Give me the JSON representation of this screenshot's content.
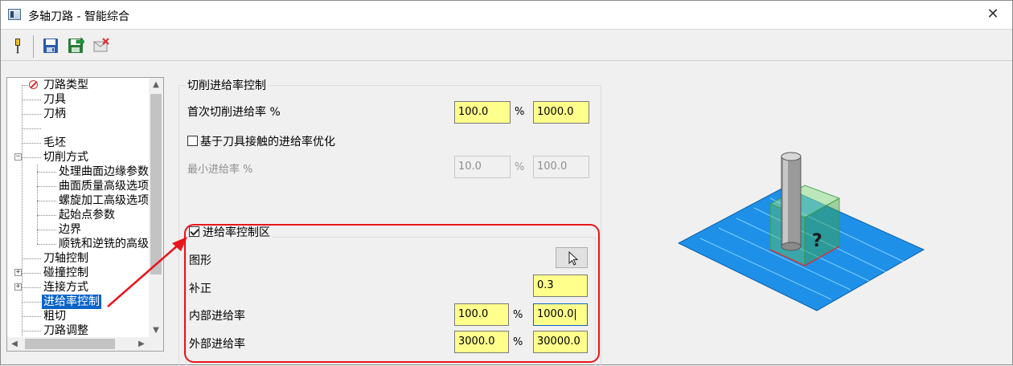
{
  "window": {
    "title": "多轴刀路 - 智能综合",
    "close_glyph": "✕"
  },
  "toolbar": {
    "buttons": [
      {
        "name": "tool-icon"
      },
      {
        "name": "save-icon"
      },
      {
        "name": "save-as-icon"
      },
      {
        "name": "cancel-icon"
      }
    ]
  },
  "tree": {
    "items": [
      {
        "label": "刀路类型",
        "level": 0,
        "icon": "no-sign-icon"
      },
      {
        "label": "刀具",
        "level": 0
      },
      {
        "label": "刀柄",
        "level": 0
      },
      {
        "label": "",
        "level": 0
      },
      {
        "label": "毛坯",
        "level": 0
      },
      {
        "label": "切削方式",
        "level": 0,
        "expander": "−"
      },
      {
        "label": "处理曲面边缘参数",
        "level": 1
      },
      {
        "label": "曲面质量高级选项",
        "level": 1
      },
      {
        "label": "螺旋加工高级选项",
        "level": 1
      },
      {
        "label": "起始点参数",
        "level": 1
      },
      {
        "label": "边界",
        "level": 1
      },
      {
        "label": "顺铣和逆铣的高级",
        "level": 1
      },
      {
        "label": "刀轴控制",
        "level": 0
      },
      {
        "label": "碰撞控制",
        "level": 0,
        "expander": "+"
      },
      {
        "label": "连接方式",
        "level": 0,
        "expander": "+"
      },
      {
        "label": "进给率控制",
        "level": 0,
        "selected": true
      },
      {
        "label": "粗切",
        "level": 0
      },
      {
        "label": "刀路调整",
        "level": 0
      }
    ]
  },
  "form": {
    "group_title": "切削进给率控制",
    "first_cut": {
      "label": "首次切削进给率 %",
      "value1": "100.0",
      "pct": "%",
      "value2": "1000.0"
    },
    "optimize": {
      "label": "基于刀具接触的进给率优化",
      "checked": false
    },
    "min_feed": {
      "label": "最小进给率 %",
      "value1": "10.0",
      "pct": "%",
      "value2": "100.0"
    },
    "zone": {
      "label": "进给率控制区",
      "checked": true,
      "shape_label": "图形",
      "offset_label": "补正",
      "offset_value": "0.3",
      "inner": {
        "label": "内部进给率",
        "value1": "100.0",
        "pct": "%",
        "value2": "1000.0"
      },
      "outer": {
        "label": "外部进给率",
        "value1": "3000.0",
        "pct": "%",
        "value2": "30000.0"
      }
    }
  },
  "preview": {
    "question_mark": "?",
    "colors": {
      "plate": "#1e90e8",
      "plate_lines": "#7fd0ff",
      "zone_box": "#8fe08f",
      "tool": "#9a9a9a",
      "zone_edge": "#d93030"
    }
  },
  "annotation": {
    "color": "#e8151b"
  }
}
